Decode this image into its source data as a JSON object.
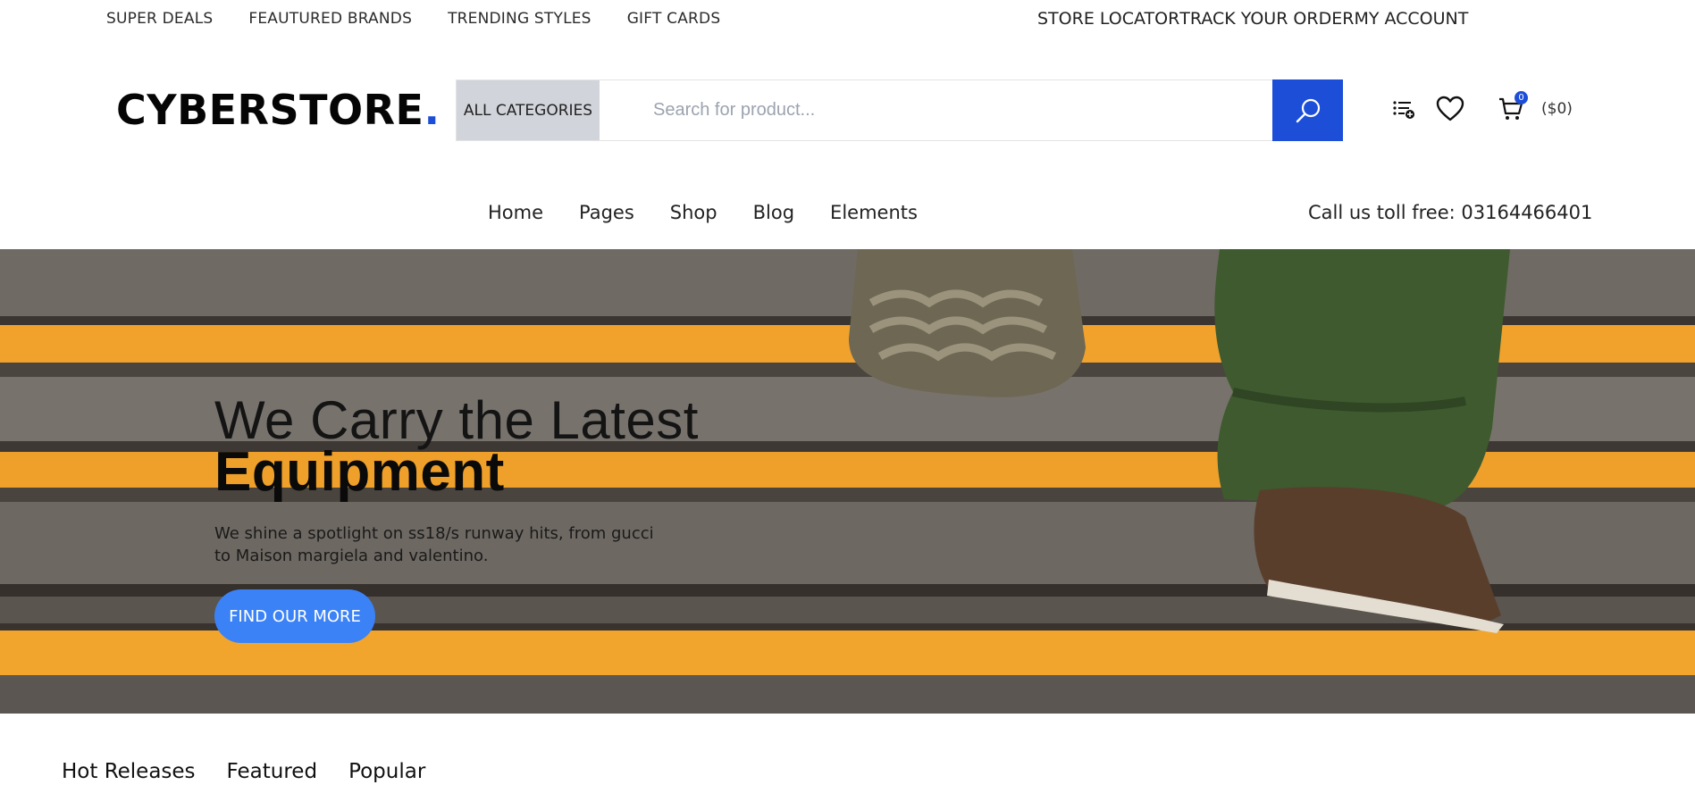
{
  "topbar": {
    "left_links": [
      "SUPER DEALS",
      "FEAUTURED BRANDS",
      "TRENDING STYLES",
      "GIFT CARDS"
    ],
    "right_links": [
      "STORE LOCATOR",
      "TRACK YOUR ORDER",
      "MY ACCOUNT"
    ]
  },
  "header": {
    "logo_text": "CYBERSTORE",
    "logo_dot": ".",
    "category_label": "ALL CATEGORIES",
    "search_placeholder": "Search for product...",
    "cart_count": "0",
    "cart_total": "($0)",
    "icons": [
      "compare-list-icon",
      "heart-icon",
      "cart-icon",
      "search-icon"
    ]
  },
  "nav": {
    "items": [
      "Home",
      "Pages",
      "Shop",
      "Blog",
      "Elements"
    ],
    "toll_free": "Call us toll free: 03164466401"
  },
  "hero": {
    "title_line1": "We Carry the Latest",
    "title_line2": "Equipment",
    "description": "We shine a spotlight on ss18/s runway hits, from gucci to Maison margiela and valentino.",
    "button_label": "FIND OUR MORE"
  },
  "tabs": [
    "Hot Releases",
    "Featured",
    "Popular"
  ],
  "colors": {
    "accent": "#1d4ed8",
    "button": "#3b82f6",
    "category_bg": "#d1d5db",
    "stripe": "#f4a62a"
  }
}
